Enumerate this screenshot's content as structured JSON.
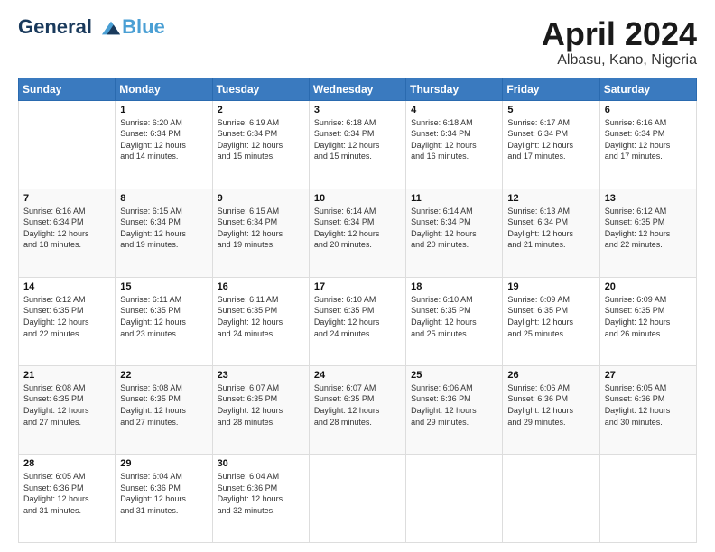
{
  "header": {
    "logo_line1": "General",
    "logo_line2": "Blue",
    "title": "April 2024",
    "subtitle": "Albasu, Kano, Nigeria"
  },
  "calendar": {
    "headers": [
      "Sunday",
      "Monday",
      "Tuesday",
      "Wednesday",
      "Thursday",
      "Friday",
      "Saturday"
    ],
    "weeks": [
      [
        {
          "day": "",
          "info": ""
        },
        {
          "day": "1",
          "info": "Sunrise: 6:20 AM\nSunset: 6:34 PM\nDaylight: 12 hours\nand 14 minutes."
        },
        {
          "day": "2",
          "info": "Sunrise: 6:19 AM\nSunset: 6:34 PM\nDaylight: 12 hours\nand 15 minutes."
        },
        {
          "day": "3",
          "info": "Sunrise: 6:18 AM\nSunset: 6:34 PM\nDaylight: 12 hours\nand 15 minutes."
        },
        {
          "day": "4",
          "info": "Sunrise: 6:18 AM\nSunset: 6:34 PM\nDaylight: 12 hours\nand 16 minutes."
        },
        {
          "day": "5",
          "info": "Sunrise: 6:17 AM\nSunset: 6:34 PM\nDaylight: 12 hours\nand 17 minutes."
        },
        {
          "day": "6",
          "info": "Sunrise: 6:16 AM\nSunset: 6:34 PM\nDaylight: 12 hours\nand 17 minutes."
        }
      ],
      [
        {
          "day": "7",
          "info": "Sunrise: 6:16 AM\nSunset: 6:34 PM\nDaylight: 12 hours\nand 18 minutes."
        },
        {
          "day": "8",
          "info": "Sunrise: 6:15 AM\nSunset: 6:34 PM\nDaylight: 12 hours\nand 19 minutes."
        },
        {
          "day": "9",
          "info": "Sunrise: 6:15 AM\nSunset: 6:34 PM\nDaylight: 12 hours\nand 19 minutes."
        },
        {
          "day": "10",
          "info": "Sunrise: 6:14 AM\nSunset: 6:34 PM\nDaylight: 12 hours\nand 20 minutes."
        },
        {
          "day": "11",
          "info": "Sunrise: 6:14 AM\nSunset: 6:34 PM\nDaylight: 12 hours\nand 20 minutes."
        },
        {
          "day": "12",
          "info": "Sunrise: 6:13 AM\nSunset: 6:34 PM\nDaylight: 12 hours\nand 21 minutes."
        },
        {
          "day": "13",
          "info": "Sunrise: 6:12 AM\nSunset: 6:35 PM\nDaylight: 12 hours\nand 22 minutes."
        }
      ],
      [
        {
          "day": "14",
          "info": "Sunrise: 6:12 AM\nSunset: 6:35 PM\nDaylight: 12 hours\nand 22 minutes."
        },
        {
          "day": "15",
          "info": "Sunrise: 6:11 AM\nSunset: 6:35 PM\nDaylight: 12 hours\nand 23 minutes."
        },
        {
          "day": "16",
          "info": "Sunrise: 6:11 AM\nSunset: 6:35 PM\nDaylight: 12 hours\nand 24 minutes."
        },
        {
          "day": "17",
          "info": "Sunrise: 6:10 AM\nSunset: 6:35 PM\nDaylight: 12 hours\nand 24 minutes."
        },
        {
          "day": "18",
          "info": "Sunrise: 6:10 AM\nSunset: 6:35 PM\nDaylight: 12 hours\nand 25 minutes."
        },
        {
          "day": "19",
          "info": "Sunrise: 6:09 AM\nSunset: 6:35 PM\nDaylight: 12 hours\nand 25 minutes."
        },
        {
          "day": "20",
          "info": "Sunrise: 6:09 AM\nSunset: 6:35 PM\nDaylight: 12 hours\nand 26 minutes."
        }
      ],
      [
        {
          "day": "21",
          "info": "Sunrise: 6:08 AM\nSunset: 6:35 PM\nDaylight: 12 hours\nand 27 minutes."
        },
        {
          "day": "22",
          "info": "Sunrise: 6:08 AM\nSunset: 6:35 PM\nDaylight: 12 hours\nand 27 minutes."
        },
        {
          "day": "23",
          "info": "Sunrise: 6:07 AM\nSunset: 6:35 PM\nDaylight: 12 hours\nand 28 minutes."
        },
        {
          "day": "24",
          "info": "Sunrise: 6:07 AM\nSunset: 6:35 PM\nDaylight: 12 hours\nand 28 minutes."
        },
        {
          "day": "25",
          "info": "Sunrise: 6:06 AM\nSunset: 6:36 PM\nDaylight: 12 hours\nand 29 minutes."
        },
        {
          "day": "26",
          "info": "Sunrise: 6:06 AM\nSunset: 6:36 PM\nDaylight: 12 hours\nand 29 minutes."
        },
        {
          "day": "27",
          "info": "Sunrise: 6:05 AM\nSunset: 6:36 PM\nDaylight: 12 hours\nand 30 minutes."
        }
      ],
      [
        {
          "day": "28",
          "info": "Sunrise: 6:05 AM\nSunset: 6:36 PM\nDaylight: 12 hours\nand 31 minutes."
        },
        {
          "day": "29",
          "info": "Sunrise: 6:04 AM\nSunset: 6:36 PM\nDaylight: 12 hours\nand 31 minutes."
        },
        {
          "day": "30",
          "info": "Sunrise: 6:04 AM\nSunset: 6:36 PM\nDaylight: 12 hours\nand 32 minutes."
        },
        {
          "day": "",
          "info": ""
        },
        {
          "day": "",
          "info": ""
        },
        {
          "day": "",
          "info": ""
        },
        {
          "day": "",
          "info": ""
        }
      ]
    ]
  }
}
